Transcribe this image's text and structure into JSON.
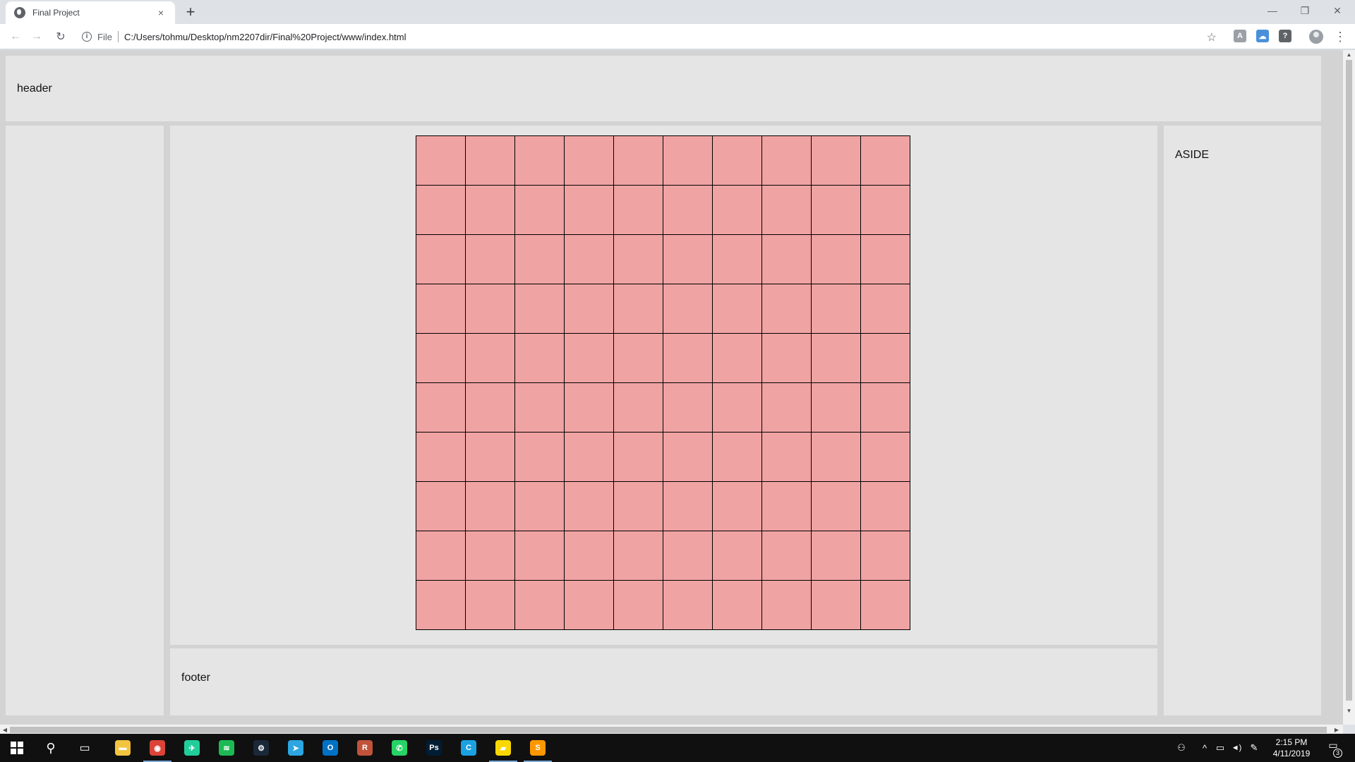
{
  "browser": {
    "tab_title": "Final Project",
    "tab_close": "×",
    "new_tab": "+",
    "scheme_label": "File",
    "url": "C:/Users/tohmu/Desktop/nm2207dir/Final%20Project/www/index.html",
    "info_glyph": "i",
    "star_glyph": "☆",
    "menu_glyph": "⋮",
    "back_glyph": "←",
    "forward_glyph": "→",
    "reload_glyph": "↻",
    "window_controls": {
      "minimize": "—",
      "restore": "❐",
      "close": "✕"
    },
    "extensions": [
      {
        "name": "acrobat-extension-icon",
        "glyph": "A",
        "color": "#9aa0a6"
      },
      {
        "name": "cloud-extension-icon",
        "glyph": "☁",
        "color": "#4a90d9"
      },
      {
        "name": "help-extension-icon",
        "glyph": "?",
        "color": "#5f6368"
      }
    ]
  },
  "page": {
    "header_label": "header",
    "aside_label": "ASIDE",
    "footer_label": "footer",
    "grid": {
      "rows": 10,
      "cols": 10,
      "cell_color": "#f0a3a3",
      "line_color": "#000000"
    }
  },
  "taskbar": {
    "apps": [
      {
        "name": "file-explorer-icon",
        "glyph": "▬",
        "color": "#f3c440",
        "running": false
      },
      {
        "name": "chrome-icon",
        "glyph": "◉",
        "color": "#db4437",
        "running": true
      },
      {
        "name": "robinhood-icon",
        "glyph": "✈",
        "color": "#21ce99",
        "running": false
      },
      {
        "name": "spotify-icon",
        "glyph": "≋",
        "color": "#1db954",
        "running": false
      },
      {
        "name": "steam-icon",
        "glyph": "⚙",
        "color": "#1b2838",
        "running": false
      },
      {
        "name": "telegram-icon",
        "glyph": "➤",
        "color": "#2ca5e0",
        "running": false
      },
      {
        "name": "outlook-icon",
        "glyph": "O",
        "color": "#0072c6",
        "running": false
      },
      {
        "name": "r-app-icon",
        "glyph": "R",
        "color": "#c0533a",
        "running": false
      },
      {
        "name": "whatsapp-icon",
        "glyph": "✆",
        "color": "#25d366",
        "running": false
      },
      {
        "name": "photoshop-icon",
        "glyph": "Ps",
        "color": "#001d34",
        "running": false
      },
      {
        "name": "c-app-icon",
        "glyph": "C",
        "color": "#1ba1e2",
        "running": false
      },
      {
        "name": "sticky-notes-icon",
        "glyph": "▰",
        "color": "#f8d800",
        "running": true
      },
      {
        "name": "sublime-text-icon",
        "glyph": "S",
        "color": "#ff9800",
        "running": true
      }
    ],
    "search_glyph": "⚲",
    "taskview_glyph": "▭",
    "tray_people": "⚇",
    "tray_chevron": "^",
    "tray_network": "▭",
    "tray_volume": "◄)",
    "tray_pen": "✎",
    "time": "2:15 PM",
    "date": "4/11/2019",
    "notification_count": "3",
    "notification_glyph": "▭"
  }
}
